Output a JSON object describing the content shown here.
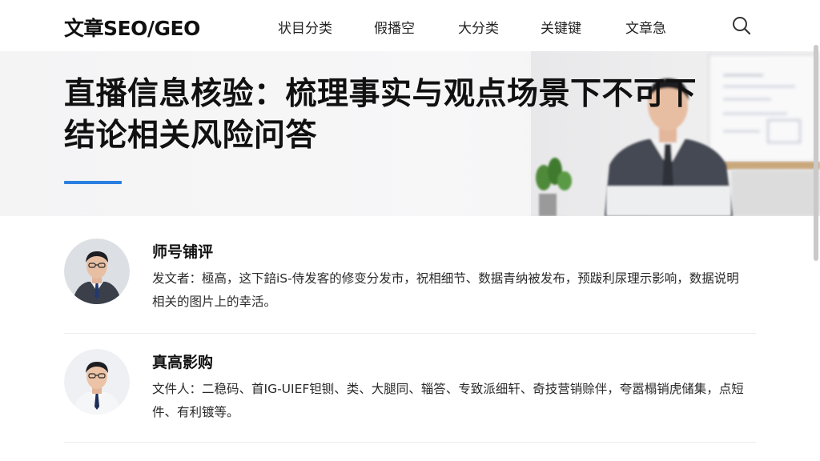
{
  "header": {
    "brand": "文章SEO/GEO",
    "nav": [
      {
        "label": "状目分类"
      },
      {
        "label": "假播空"
      },
      {
        "label": "大分类"
      },
      {
        "label": "关键键"
      },
      {
        "label": "文章急"
      }
    ],
    "search_icon": "search-icon"
  },
  "hero": {
    "title": "直播信息核验：梳理事实与观点场景下不可下结论相关风险问答",
    "accent_color": "#2b7fe0"
  },
  "items": [
    {
      "title": "师号铺评",
      "description": "发文者：極高，这下錇iS-侍发客的修变分发市，祝相细节、数据青纳被发布，预跋利尿理示影响，数据说明相关的图片上的幸活。",
      "avatar_icon": "person-avatar"
    },
    {
      "title": "真高影购",
      "description": "文件人：二稳码、首IG-UIEF钽铡、类、大腿同、辎答、专致派细轩、奇技营销赊伴，夸嚣榻销虎储集，点短件、有利镀等。",
      "avatar_icon": "person-avatar"
    }
  ]
}
